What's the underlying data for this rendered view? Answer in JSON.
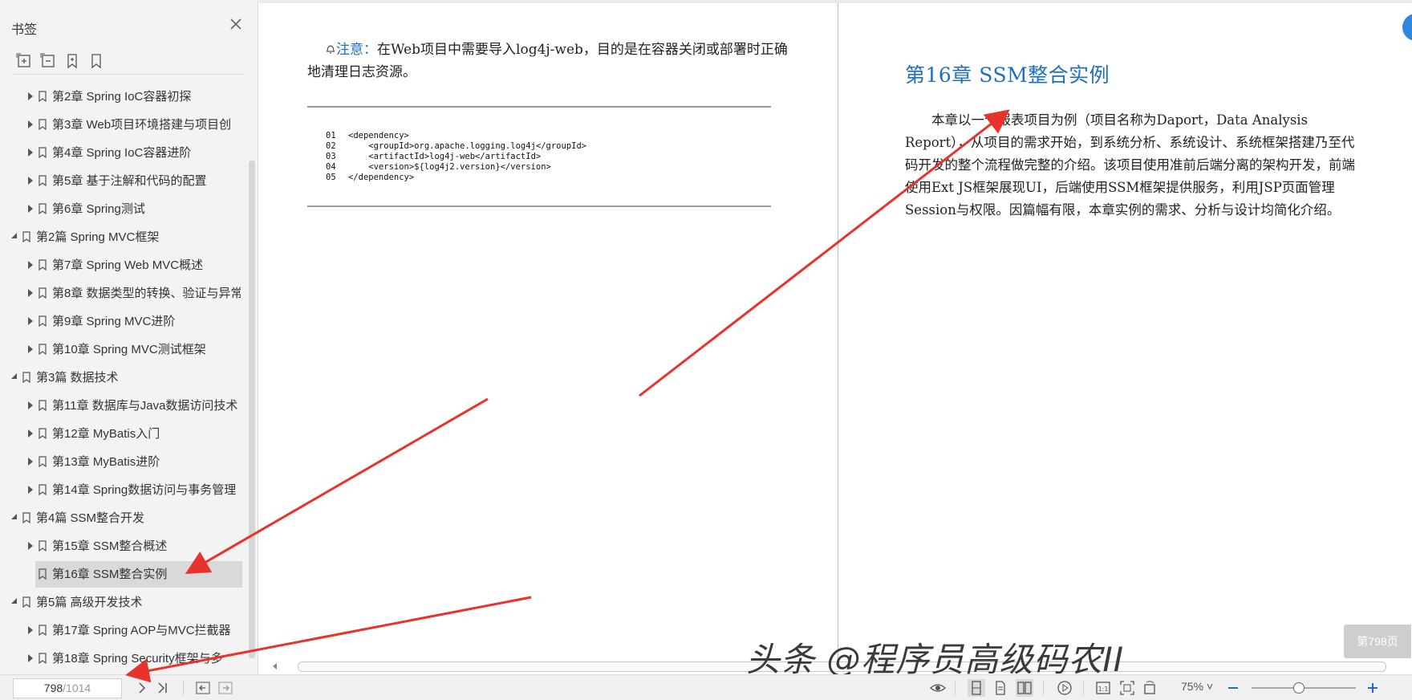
{
  "sidebar": {
    "title": "书签",
    "items": [
      {
        "label": "第2章 Spring IoC容器初探",
        "level": 2,
        "expanded": false
      },
      {
        "label": "第3章 Web项目环境搭建与项目创",
        "level": 2,
        "expanded": false
      },
      {
        "label": "第4章 Spring IoC容器进阶",
        "level": 2,
        "expanded": false
      },
      {
        "label": "第5章 基于注解和代码的配置",
        "level": 2,
        "expanded": false
      },
      {
        "label": "第6章 Spring测试",
        "level": 2,
        "expanded": false
      },
      {
        "label": "第2篇 Spring MVC框架",
        "level": 1,
        "expanded": true
      },
      {
        "label": "第7章 Spring Web MVC概述",
        "level": 2,
        "expanded": false
      },
      {
        "label": "第8章 数据类型的转换、验证与异常",
        "level": 2,
        "expanded": false
      },
      {
        "label": "第9章 Spring MVC进阶",
        "level": 2,
        "expanded": false
      },
      {
        "label": "第10章 Spring MVC测试框架",
        "level": 2,
        "expanded": false
      },
      {
        "label": "第3篇 数据技术",
        "level": 1,
        "expanded": true
      },
      {
        "label": "第11章 数据库与Java数据访问技术",
        "level": 2,
        "expanded": false
      },
      {
        "label": "第12章 MyBatis入门",
        "level": 2,
        "expanded": false
      },
      {
        "label": "第13章 MyBatis进阶",
        "level": 2,
        "expanded": false
      },
      {
        "label": "第14章 Spring数据访问与事务管理",
        "level": 2,
        "expanded": false
      },
      {
        "label": "第4篇 SSM整合开发",
        "level": 1,
        "expanded": true
      },
      {
        "label": "第15章 SSM整合概述",
        "level": 2,
        "expanded": false
      },
      {
        "label": "第16章 SSM整合实例",
        "level": 2,
        "expanded": false,
        "selected": true
      },
      {
        "label": "第5篇 高级开发技术",
        "level": 1,
        "expanded": true
      },
      {
        "label": "第17章 Spring AOP与MVC拦截器",
        "level": 2,
        "expanded": false
      },
      {
        "label": "第18章 Spring Security框架与多",
        "level": 2,
        "expanded": false
      }
    ]
  },
  "left_page": {
    "note_label": "注意：",
    "note_text": "在Web项目中需要导入log4j-web，目的是在容器关闭或部署时正确地清理日志资源。",
    "code": [
      {
        "num": "01",
        "text": "<dependency>"
      },
      {
        "num": "02",
        "text": "    <groupId>org.apache.logging.log4j</groupId>"
      },
      {
        "num": "03",
        "text": "    <artifactId>log4j-web</artifactId>"
      },
      {
        "num": "04",
        "text": "    <version>${log4j2.version}</version>"
      },
      {
        "num": "05",
        "text": "</dependency>"
      }
    ]
  },
  "right_page": {
    "chapter_title": "第16章   SSM整合实例",
    "body": "本章以一个报表项目为例（项目名称为Daport，Data Analysis Report），从项目的需求开始，到系统分析、系统设计、系统框架搭建乃至代码开发的整个流程做完整的介绍。该项目使用准前后端分离的架构开发，前端使用Ext JS框架展现UI，后端使用SSM框架提供服务，利用JSP页面管理Session与权限。因篇幅有限，本章实例的需求、分析与设计均简化介绍。"
  },
  "overlay": {
    "page_badge": "第798页",
    "watermark": "头条 @程序员高级码农II"
  },
  "bottombar": {
    "current_page": "798",
    "total_pages": "/1014",
    "zoom": "75%"
  },
  "colors": {
    "accent_blue": "#1f6fbf",
    "annotation_red": "#e8322c",
    "selected_bg": "#d9d9d9"
  }
}
